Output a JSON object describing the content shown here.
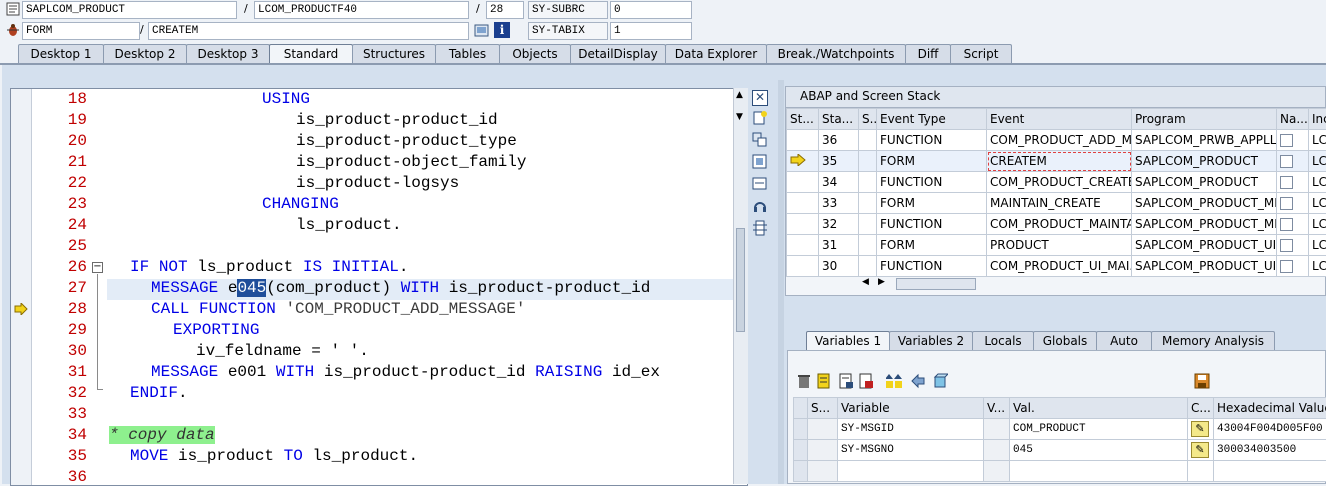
{
  "header": {
    "row1": {
      "program": "SAPLCOM_PRODUCT",
      "include": "LCOM_PRODUCTF40",
      "line": "28",
      "subrc_label": "SY-SUBRC",
      "subrc_value": "0"
    },
    "row2": {
      "type": "FORM",
      "name": "CREATEM",
      "tabix_label": "SY-TABIX",
      "tabix_value": "1"
    },
    "separator": "/"
  },
  "tabs": [
    "Desktop 1",
    "Desktop 2",
    "Desktop 3",
    "Standard",
    "Structures",
    "Tables",
    "Objects",
    "DetailDisplay",
    "Data Explorer",
    "Break./Watchpoints",
    "Diff",
    "Script"
  ],
  "active_tab": "Standard",
  "editor": {
    "line_numbers": [
      "18",
      "19",
      "20",
      "21",
      "22",
      "23",
      "24",
      "25",
      "26",
      "27",
      "28",
      "29",
      "30",
      "31",
      "32",
      "33",
      "34",
      "35",
      "36"
    ],
    "lines": {
      "l18": "USING",
      "l19": "is_product-product_id",
      "l20": "is_product-product_type",
      "l21": "is_product-object_family",
      "l22": "is_product-logsys",
      "l23": "CHANGING",
      "l24": "ls_product.",
      "l26_kw1": "IF",
      "l26_kw2": "NOT",
      "l26_var": "ls_product",
      "l26_kw3": "IS INITIAL",
      "l26_end": ".",
      "l27_kw": "MESSAGE",
      "l27_e": "e",
      "l27_hl": "045",
      "l27_paren": "(com_product)",
      "l27_with": "WITH",
      "l27_rest": "is_product-product_id",
      "l28_kw": "CALL FUNCTION",
      "l28_str": "'COM_PRODUCT_ADD_MESSAGE'",
      "l29_kw": "EXPORTING",
      "l30_var": "iv_feldname",
      "l30_rest": "= ' '.",
      "l31_kw": "MESSAGE",
      "l31_msg": "e001",
      "l31_with": "WITH",
      "l31_var": "is_product-product_id",
      "l31_kw2": "RAISING",
      "l31_rest": "id_ex",
      "l32_kw": "ENDIF",
      "l32_end": ".",
      "l34_cmt": "* copy data",
      "l35_kw": "MOVE",
      "l35_var": "is_product",
      "l35_to": "TO",
      "l35_rest": "ls_product."
    }
  },
  "stack": {
    "title": "ABAP and Screen Stack",
    "columns": [
      "St...",
      "Sta...",
      "S...",
      "Event Type",
      "Event",
      "Program",
      "Na...",
      "Inc"
    ],
    "rows": [
      {
        "level": "36",
        "type": "FUNCTION",
        "event": "COM_PRODUCT_ADD_M...",
        "program": "SAPLCOM_PRWB_APPLL...",
        "inc": "LC"
      },
      {
        "level": "35",
        "type": "FORM",
        "event": "CREATEM",
        "program": "SAPLCOM_PRODUCT",
        "inc": "LC",
        "current": true
      },
      {
        "level": "34",
        "type": "FUNCTION",
        "event": "COM_PRODUCT_CREATE...",
        "program": "SAPLCOM_PRODUCT",
        "inc": "LC"
      },
      {
        "level": "33",
        "type": "FORM",
        "event": "MAINTAIN_CREATE",
        "program": "SAPLCOM_PRODUCT_MN...",
        "inc": "LC"
      },
      {
        "level": "32",
        "type": "FUNCTION",
        "event": "COM_PRODUCT_MAINTA...",
        "program": "SAPLCOM_PRODUCT_MN...",
        "inc": "LC"
      },
      {
        "level": "31",
        "type": "FORM",
        "event": "PRODUCT",
        "program": "SAPLCOM_PRODUCT_UI...",
        "inc": "LC"
      },
      {
        "level": "30",
        "type": "FUNCTION",
        "event": "COM_PRODUCT_UI_MAI...",
        "program": "SAPLCOM_PRODUCT_UI...",
        "inc": "LC"
      }
    ]
  },
  "var_tabs": [
    "Variables 1",
    "Variables 2",
    "Locals",
    "Globals",
    "Auto",
    "Memory Analysis"
  ],
  "active_var_tab": "Variables 1",
  "variables": {
    "columns": [
      "S...",
      "Variable",
      "V...",
      "Val.",
      "C...",
      "Hexadecimal Value"
    ],
    "rows": [
      {
        "name": "SY-MSGID",
        "value": "COM_PRODUCT",
        "hex": "43004F004D005F00"
      },
      {
        "name": "SY-MSGNO",
        "value": "045",
        "hex": "300034003500"
      }
    ]
  },
  "colors": {
    "keyword": "#0000e6",
    "line_number": "#c00000",
    "comment_bg": "#8ef08e",
    "highlight": "#1f4e9a",
    "current_line": "#e3ecf7"
  }
}
